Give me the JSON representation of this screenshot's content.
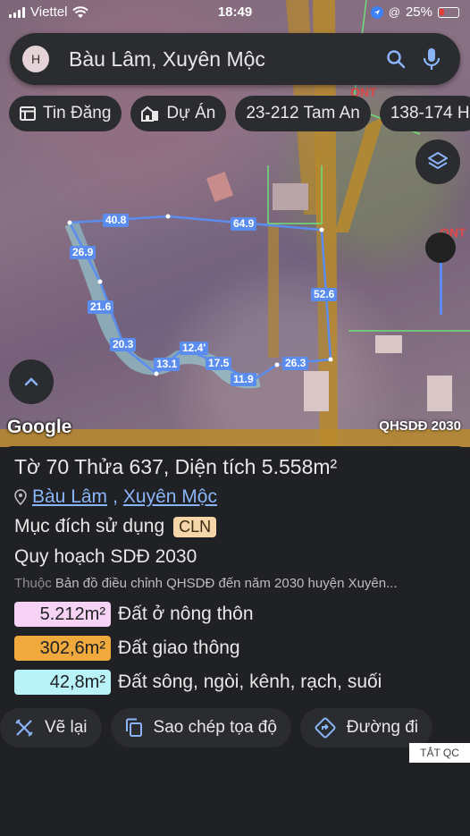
{
  "status_bar": {
    "carrier": "Viettel",
    "time": "18:49",
    "battery": "25%"
  },
  "search": {
    "avatar_letter": "H",
    "query": "Bàu Lâm, Xuyên Mộc"
  },
  "chips": [
    {
      "icon": "newspaper-icon",
      "label": "Tin Đăng"
    },
    {
      "icon": "building-icon",
      "label": "Dự Án"
    },
    {
      "icon": "",
      "label": "23-212 Tam An"
    },
    {
      "icon": "",
      "label": "138-174 H"
    }
  ],
  "map": {
    "google_label": "Google",
    "layer_label": "QHSDĐ 2030",
    "segment_labels": [
      "40.8",
      "64.9",
      "26.9",
      "21.6",
      "52.6",
      "20.3",
      "12.4'",
      "13.1",
      "17.5",
      "26.3",
      "11.9"
    ]
  },
  "parcel": {
    "title": "Tờ 70 Thửa 637, Diện tích 5.558m²",
    "commune": "Bàu Lâm",
    "district": "Xuyên Mộc",
    "purpose_label": "Mục đích sử dụng",
    "purpose_code": "CLN",
    "plan_label": "Quy hoạch SDĐ 2030",
    "belongs_prefix": "Thuộc",
    "belongs_text": "Bản đồ điều chỉnh QHSDĐ đến năm 2030 huyện Xuyên...",
    "areas": [
      {
        "value": "5.212m²",
        "label": "Đất ở nông thôn",
        "color": "#f6d2f5"
      },
      {
        "value": "302,6m²",
        "label": "Đất giao thông",
        "color": "#f0a93c"
      },
      {
        "value": "42,8m²",
        "label": "Đất sông, ngòi, kênh, rạch, suối",
        "color": "#b9f3f7"
      }
    ]
  },
  "actions": {
    "redraw": "Vẽ lại",
    "copy_coords": "Sao chép tọa độ",
    "directions": "Đường đi"
  },
  "ad_tag": "TẮT QC"
}
